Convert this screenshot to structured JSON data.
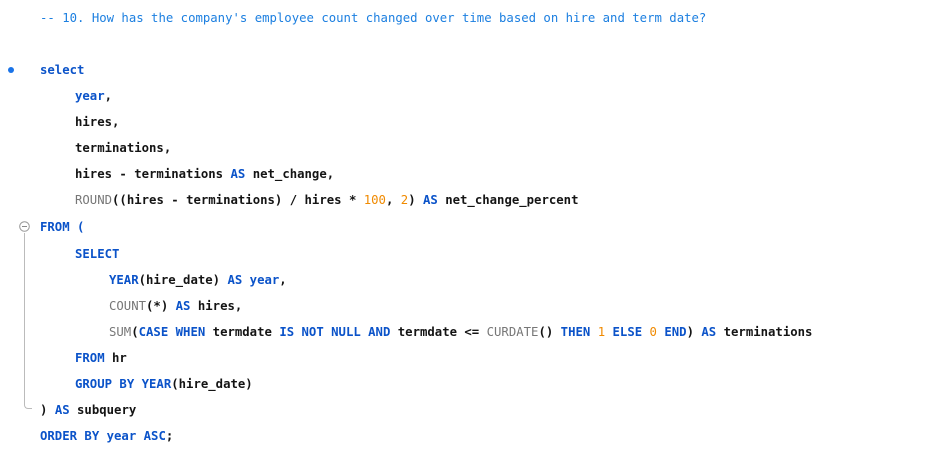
{
  "editor": {
    "lines": [
      {
        "tokens": [
          {
            "t": "-- 10. How has the company's employee count changed over time based on hire and term date?",
            "c": "cmt"
          }
        ]
      },
      {
        "tokens": [
          {
            "t": "select",
            "c": "kw"
          }
        ]
      },
      {
        "tokens": [
          {
            "t": "year",
            "c": "kw"
          },
          {
            "t": ",",
            "c": "pl"
          }
        ]
      },
      {
        "tokens": [
          {
            "t": "hires,",
            "c": "txt"
          }
        ]
      },
      {
        "tokens": [
          {
            "t": "terminations,",
            "c": "txt"
          }
        ]
      },
      {
        "tokens": [
          {
            "t": "hires - terminations ",
            "c": "txt"
          },
          {
            "t": "AS",
            "c": "kw"
          },
          {
            "t": " net_change,",
            "c": "txt"
          }
        ]
      },
      {
        "tokens": [
          {
            "t": "ROUND",
            "c": "fn"
          },
          {
            "t": "((hires - terminations) / hires * ",
            "c": "txt"
          },
          {
            "t": "100",
            "c": "num"
          },
          {
            "t": ", ",
            "c": "txt"
          },
          {
            "t": "2",
            "c": "num"
          },
          {
            "t": ") ",
            "c": "txt"
          },
          {
            "t": "AS",
            "c": "kw"
          },
          {
            "t": " net_change_percent",
            "c": "txt"
          }
        ]
      },
      {
        "tokens": [
          {
            "t": "FROM (",
            "c": "kw"
          }
        ]
      },
      {
        "tokens": [
          {
            "t": "SELECT",
            "c": "kw"
          }
        ]
      },
      {
        "tokens": [
          {
            "t": "YEAR",
            "c": "kw"
          },
          {
            "t": "(hire_date) ",
            "c": "txt"
          },
          {
            "t": "AS year",
            "c": "kw"
          },
          {
            "t": ",",
            "c": "txt"
          }
        ]
      },
      {
        "tokens": [
          {
            "t": "COUNT",
            "c": "fn"
          },
          {
            "t": "(*) ",
            "c": "txt"
          },
          {
            "t": "AS",
            "c": "kw"
          },
          {
            "t": " hires,",
            "c": "txt"
          }
        ]
      },
      {
        "tokens": [
          {
            "t": "SUM",
            "c": "fn"
          },
          {
            "t": "(",
            "c": "txt"
          },
          {
            "t": "CASE WHEN",
            "c": "kw"
          },
          {
            "t": " termdate ",
            "c": "txt"
          },
          {
            "t": "IS NOT NULL AND",
            "c": "kw"
          },
          {
            "t": " termdate <= ",
            "c": "txt"
          },
          {
            "t": "CURDATE",
            "c": "fn"
          },
          {
            "t": "() ",
            "c": "txt"
          },
          {
            "t": "THEN",
            "c": "kw"
          },
          {
            "t": " ",
            "c": "txt"
          },
          {
            "t": "1",
            "c": "num"
          },
          {
            "t": " ",
            "c": "txt"
          },
          {
            "t": "ELSE",
            "c": "kw"
          },
          {
            "t": " ",
            "c": "txt"
          },
          {
            "t": "0",
            "c": "num"
          },
          {
            "t": " ",
            "c": "txt"
          },
          {
            "t": "END",
            "c": "kw"
          },
          {
            "t": ") ",
            "c": "txt"
          },
          {
            "t": "AS",
            "c": "kw"
          },
          {
            "t": " terminations",
            "c": "txt"
          }
        ]
      },
      {
        "tokens": [
          {
            "t": "FROM",
            "c": "kw"
          },
          {
            "t": " hr",
            "c": "txt"
          }
        ]
      },
      {
        "tokens": [
          {
            "t": "GROUP BY YEAR",
            "c": "kw"
          },
          {
            "t": "(hire_date)",
            "c": "txt"
          }
        ]
      },
      {
        "tokens": [
          {
            "t": ") ",
            "c": "txt"
          },
          {
            "t": "AS",
            "c": "kw"
          },
          {
            "t": " subquery",
            "c": "txt"
          }
        ]
      },
      {
        "tokens": [
          {
            "t": "ORDER BY year ASC",
            "c": "kw"
          },
          {
            "t": ";",
            "c": "txt"
          }
        ]
      }
    ]
  },
  "icons": {
    "bullet": "breakpoint-dot-icon",
    "fold": "fold-minus-icon"
  }
}
